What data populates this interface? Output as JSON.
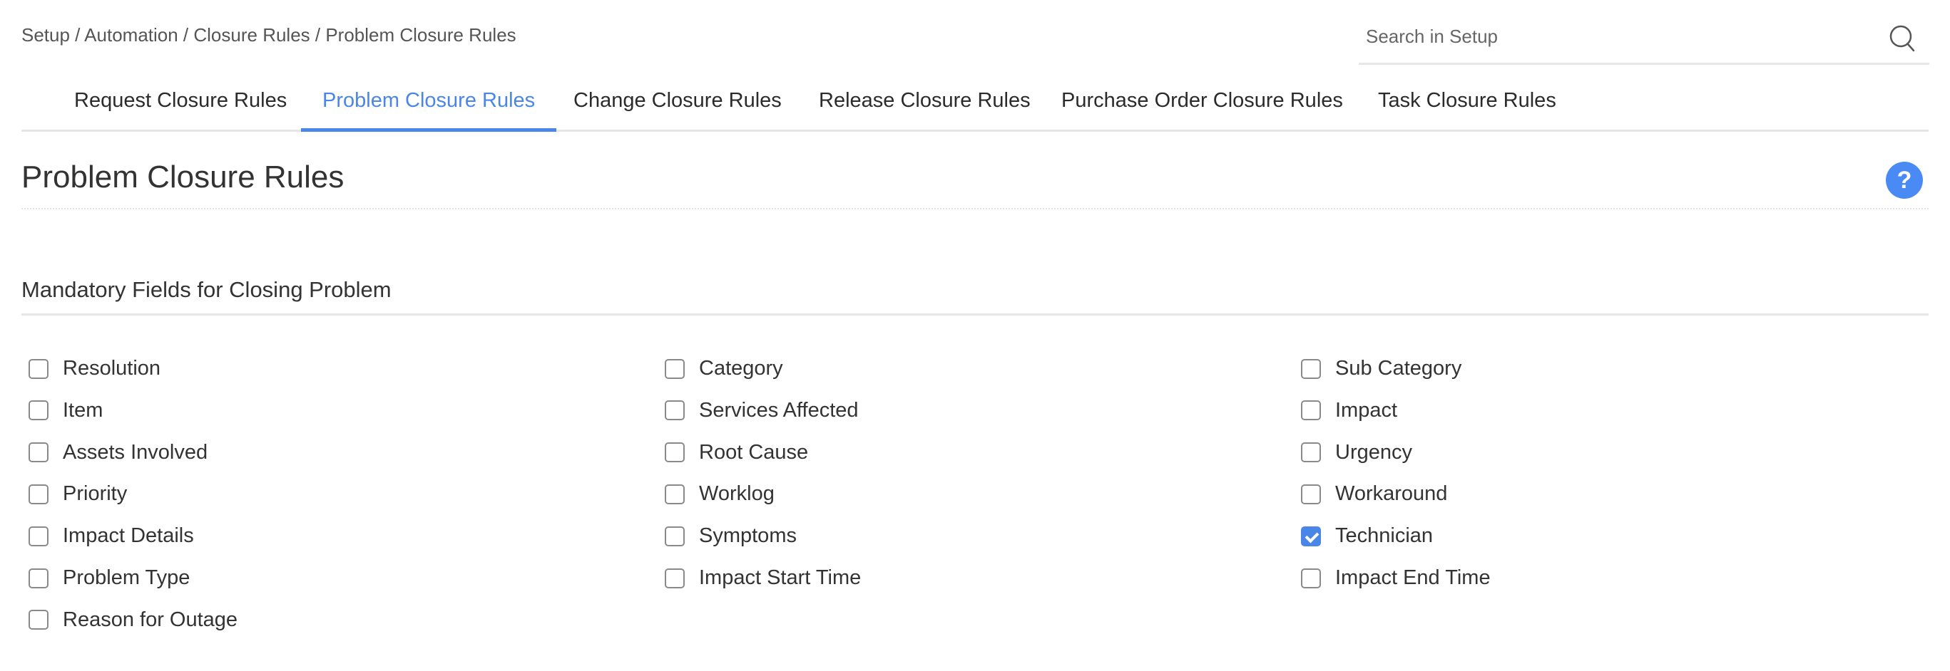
{
  "breadcrumb": "Setup / Automation / Closure Rules / Problem Closure Rules",
  "search": {
    "placeholder": "Search in Setup",
    "value": ""
  },
  "tabs": [
    {
      "label": "Request Closure Rules",
      "active": false
    },
    {
      "label": "Problem Closure Rules",
      "active": true
    },
    {
      "label": "Change Closure Rules",
      "active": false
    },
    {
      "label": "Release Closure Rules",
      "active": false
    },
    {
      "label": "Purchase Order Closure Rules",
      "active": false
    },
    {
      "label": "Task Closure Rules",
      "active": false
    }
  ],
  "page_title": "Problem Closure Rules",
  "help_label": "?",
  "section_title": "Mandatory Fields for Closing Problem",
  "colors": {
    "accent": "#4a86e8",
    "help": "#4a8af4"
  },
  "fields": [
    [
      {
        "label": "Resolution",
        "checked": false
      },
      {
        "label": "Category",
        "checked": false
      },
      {
        "label": "Sub Category",
        "checked": false
      }
    ],
    [
      {
        "label": "Item",
        "checked": false
      },
      {
        "label": "Services Affected",
        "checked": false
      },
      {
        "label": "Impact",
        "checked": false
      }
    ],
    [
      {
        "label": "Assets Involved",
        "checked": false
      },
      {
        "label": "Root Cause",
        "checked": false
      },
      {
        "label": "Urgency",
        "checked": false
      }
    ],
    [
      {
        "label": "Priority",
        "checked": false
      },
      {
        "label": "Worklog",
        "checked": false
      },
      {
        "label": "Workaround",
        "checked": false
      }
    ],
    [
      {
        "label": "Impact Details",
        "checked": false
      },
      {
        "label": "Symptoms",
        "checked": false
      },
      {
        "label": "Technician",
        "checked": true
      }
    ],
    [
      {
        "label": "Problem Type",
        "checked": false
      },
      {
        "label": "Impact Start Time",
        "checked": false
      },
      {
        "label": "Impact End Time",
        "checked": false
      }
    ],
    [
      {
        "label": "Reason for Outage",
        "checked": false
      }
    ]
  ]
}
